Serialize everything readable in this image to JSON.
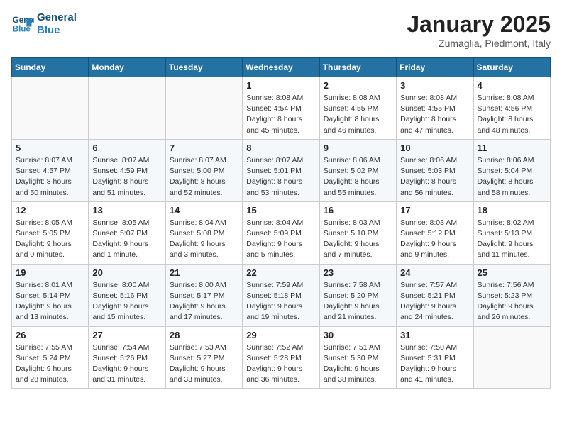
{
  "logo": {
    "line1": "General",
    "line2": "Blue"
  },
  "title": "January 2025",
  "subtitle": "Zumaglia, Piedmont, Italy",
  "days_of_week": [
    "Sunday",
    "Monday",
    "Tuesday",
    "Wednesday",
    "Thursday",
    "Friday",
    "Saturday"
  ],
  "weeks": [
    [
      {
        "day": "",
        "info": ""
      },
      {
        "day": "",
        "info": ""
      },
      {
        "day": "",
        "info": ""
      },
      {
        "day": "1",
        "info": "Sunrise: 8:08 AM\nSunset: 4:54 PM\nDaylight: 8 hours\nand 45 minutes."
      },
      {
        "day": "2",
        "info": "Sunrise: 8:08 AM\nSunset: 4:55 PM\nDaylight: 8 hours\nand 46 minutes."
      },
      {
        "day": "3",
        "info": "Sunrise: 8:08 AM\nSunset: 4:55 PM\nDaylight: 8 hours\nand 47 minutes."
      },
      {
        "day": "4",
        "info": "Sunrise: 8:08 AM\nSunset: 4:56 PM\nDaylight: 8 hours\nand 48 minutes."
      }
    ],
    [
      {
        "day": "5",
        "info": "Sunrise: 8:07 AM\nSunset: 4:57 PM\nDaylight: 8 hours\nand 50 minutes."
      },
      {
        "day": "6",
        "info": "Sunrise: 8:07 AM\nSunset: 4:59 PM\nDaylight: 8 hours\nand 51 minutes."
      },
      {
        "day": "7",
        "info": "Sunrise: 8:07 AM\nSunset: 5:00 PM\nDaylight: 8 hours\nand 52 minutes."
      },
      {
        "day": "8",
        "info": "Sunrise: 8:07 AM\nSunset: 5:01 PM\nDaylight: 8 hours\nand 53 minutes."
      },
      {
        "day": "9",
        "info": "Sunrise: 8:06 AM\nSunset: 5:02 PM\nDaylight: 8 hours\nand 55 minutes."
      },
      {
        "day": "10",
        "info": "Sunrise: 8:06 AM\nSunset: 5:03 PM\nDaylight: 8 hours\nand 56 minutes."
      },
      {
        "day": "11",
        "info": "Sunrise: 8:06 AM\nSunset: 5:04 PM\nDaylight: 8 hours\nand 58 minutes."
      }
    ],
    [
      {
        "day": "12",
        "info": "Sunrise: 8:05 AM\nSunset: 5:05 PM\nDaylight: 9 hours\nand 0 minutes."
      },
      {
        "day": "13",
        "info": "Sunrise: 8:05 AM\nSunset: 5:07 PM\nDaylight: 9 hours\nand 1 minute."
      },
      {
        "day": "14",
        "info": "Sunrise: 8:04 AM\nSunset: 5:08 PM\nDaylight: 9 hours\nand 3 minutes."
      },
      {
        "day": "15",
        "info": "Sunrise: 8:04 AM\nSunset: 5:09 PM\nDaylight: 9 hours\nand 5 minutes."
      },
      {
        "day": "16",
        "info": "Sunrise: 8:03 AM\nSunset: 5:10 PM\nDaylight: 9 hours\nand 7 minutes."
      },
      {
        "day": "17",
        "info": "Sunrise: 8:03 AM\nSunset: 5:12 PM\nDaylight: 9 hours\nand 9 minutes."
      },
      {
        "day": "18",
        "info": "Sunrise: 8:02 AM\nSunset: 5:13 PM\nDaylight: 9 hours\nand 11 minutes."
      }
    ],
    [
      {
        "day": "19",
        "info": "Sunrise: 8:01 AM\nSunset: 5:14 PM\nDaylight: 9 hours\nand 13 minutes."
      },
      {
        "day": "20",
        "info": "Sunrise: 8:00 AM\nSunset: 5:16 PM\nDaylight: 9 hours\nand 15 minutes."
      },
      {
        "day": "21",
        "info": "Sunrise: 8:00 AM\nSunset: 5:17 PM\nDaylight: 9 hours\nand 17 minutes."
      },
      {
        "day": "22",
        "info": "Sunrise: 7:59 AM\nSunset: 5:18 PM\nDaylight: 9 hours\nand 19 minutes."
      },
      {
        "day": "23",
        "info": "Sunrise: 7:58 AM\nSunset: 5:20 PM\nDaylight: 9 hours\nand 21 minutes."
      },
      {
        "day": "24",
        "info": "Sunrise: 7:57 AM\nSunset: 5:21 PM\nDaylight: 9 hours\nand 24 minutes."
      },
      {
        "day": "25",
        "info": "Sunrise: 7:56 AM\nSunset: 5:23 PM\nDaylight: 9 hours\nand 26 minutes."
      }
    ],
    [
      {
        "day": "26",
        "info": "Sunrise: 7:55 AM\nSunset: 5:24 PM\nDaylight: 9 hours\nand 28 minutes."
      },
      {
        "day": "27",
        "info": "Sunrise: 7:54 AM\nSunset: 5:26 PM\nDaylight: 9 hours\nand 31 minutes."
      },
      {
        "day": "28",
        "info": "Sunrise: 7:53 AM\nSunset: 5:27 PM\nDaylight: 9 hours\nand 33 minutes."
      },
      {
        "day": "29",
        "info": "Sunrise: 7:52 AM\nSunset: 5:28 PM\nDaylight: 9 hours\nand 36 minutes."
      },
      {
        "day": "30",
        "info": "Sunrise: 7:51 AM\nSunset: 5:30 PM\nDaylight: 9 hours\nand 38 minutes."
      },
      {
        "day": "31",
        "info": "Sunrise: 7:50 AM\nSunset: 5:31 PM\nDaylight: 9 hours\nand 41 minutes."
      },
      {
        "day": "",
        "info": ""
      }
    ]
  ]
}
